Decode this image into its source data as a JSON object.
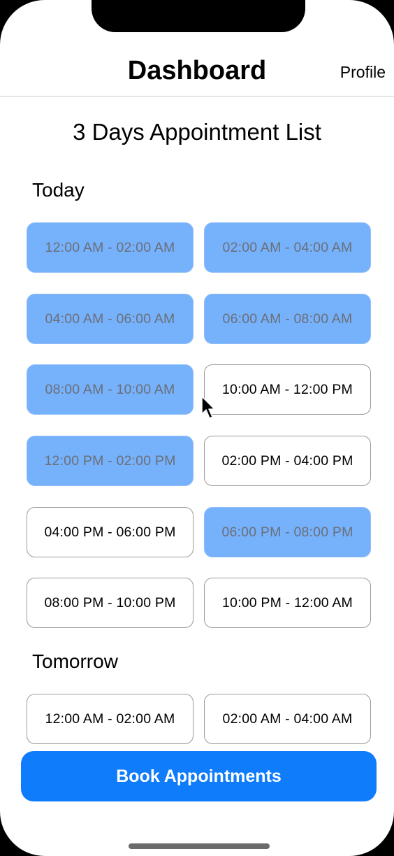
{
  "nav": {
    "title": "Dashboard",
    "profile_label": "Profile"
  },
  "list_title": "3 Days Appointment List",
  "sections": [
    {
      "label": "Today",
      "slots": [
        {
          "label": "12:00 AM - 02:00 AM",
          "booked": true
        },
        {
          "label": "02:00 AM - 04:00 AM",
          "booked": true
        },
        {
          "label": "04:00 AM - 06:00 AM",
          "booked": true
        },
        {
          "label": "06:00 AM - 08:00 AM",
          "booked": true
        },
        {
          "label": "08:00 AM - 10:00 AM",
          "booked": true
        },
        {
          "label": "10:00 AM - 12:00 PM",
          "booked": false
        },
        {
          "label": "12:00 PM - 02:00 PM",
          "booked": true
        },
        {
          "label": "02:00 PM - 04:00 PM",
          "booked": false
        },
        {
          "label": "04:00 PM - 06:00 PM",
          "booked": false
        },
        {
          "label": "06:00 PM - 08:00 PM",
          "booked": true
        },
        {
          "label": "08:00 PM - 10:00 PM",
          "booked": false
        },
        {
          "label": "10:00 PM - 12:00 AM",
          "booked": false
        }
      ]
    },
    {
      "label": "Tomorrow",
      "slots": [
        {
          "label": "12:00 AM - 02:00 AM",
          "booked": false
        },
        {
          "label": "02:00 AM - 04:00 AM",
          "booked": false
        }
      ]
    }
  ],
  "book_button_label": "Book Appointments",
  "colors": {
    "booked_fill": "#76b1fc",
    "booked_text": "#6b6f77",
    "accent": "#0f7cfb",
    "slot_border": "#9a9a9a"
  }
}
